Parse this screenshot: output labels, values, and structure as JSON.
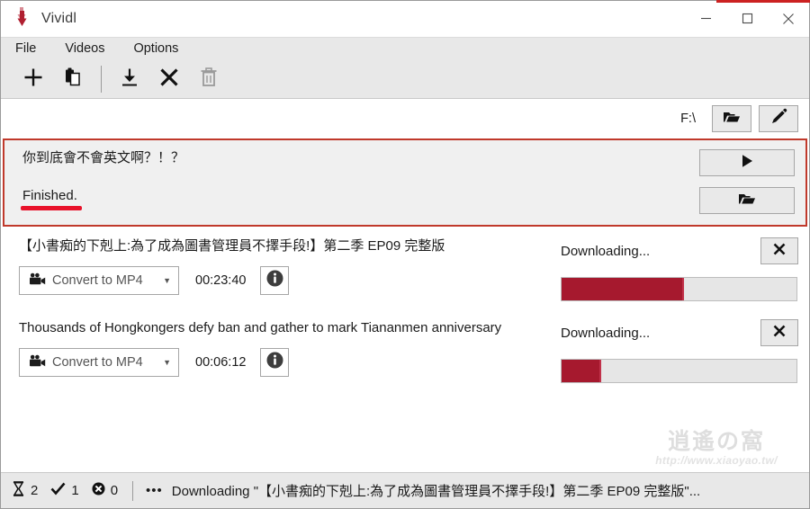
{
  "window": {
    "title": "Vividl",
    "icon": "vividl-heart-logo",
    "controls": {
      "minimize": "minimize-icon",
      "maximize": "maximize-icon",
      "close": "close-icon"
    },
    "accent_red": "#cc2222"
  },
  "menubar": {
    "items": [
      {
        "label": "File",
        "name": "menu-file"
      },
      {
        "label": "Videos",
        "name": "menu-videos"
      },
      {
        "label": "Options",
        "name": "menu-options"
      }
    ]
  },
  "toolbar": {
    "buttons": [
      {
        "name": "add-icon",
        "tip": "Add"
      },
      {
        "name": "paste-clipboard-icon",
        "tip": "Paste"
      },
      {
        "name": "download-icon",
        "tip": "Download"
      },
      {
        "name": "cancel-icon",
        "tip": "Cancel"
      },
      {
        "name": "trash-icon",
        "tip": "Delete",
        "disabled": true
      }
    ]
  },
  "path_row": {
    "label": "F:\\",
    "browse_icon": "open-folder-icon",
    "edit_icon": "pencil-icon"
  },
  "downloads": [
    {
      "selected": true,
      "title": "你到底會不會英文啊？！？",
      "status": "Finished.",
      "status_underline_color": "#e8122a",
      "play_icon": "play-triangle-icon",
      "folder_icon": "open-folder-icon"
    },
    {
      "selected": false,
      "title": "【小書痴的下剋上:為了成為圖書管理員不擇手段!】第二季 EP09 完整版",
      "convert_label": "Convert to MP4",
      "convert_icon": "movie-camera-icon",
      "duration": "00:23:40",
      "info_icon": "info-icon",
      "status": "Downloading...",
      "cancel_icon": "close-x-icon",
      "progress_percent": 52,
      "progress_color": "#a6192e"
    },
    {
      "selected": false,
      "title": "Thousands of Hongkongers defy ban and gather to mark Tiananmen anniversary",
      "convert_label": "Convert to MP4",
      "convert_icon": "movie-camera-icon",
      "duration": "00:06:12",
      "info_icon": "info-icon",
      "status": "Downloading...",
      "cancel_icon": "close-x-icon",
      "progress_percent": 17,
      "progress_color": "#a6192e"
    }
  ],
  "watermark": {
    "glyph": "逍遙の窩",
    "url": "http://www.xiaoyao.tw/"
  },
  "statusbar": {
    "running_icon": "hourglass-icon",
    "running_count": "2",
    "done_icon": "checkmark-icon",
    "done_count": "1",
    "failed_icon": "error-circle-icon",
    "failed_count": "0",
    "dots": "•••",
    "message": "Downloading \"【小書痴的下剋上:為了成為圖書管理員不擇手段!】第二季 EP09 完整版\"..."
  }
}
